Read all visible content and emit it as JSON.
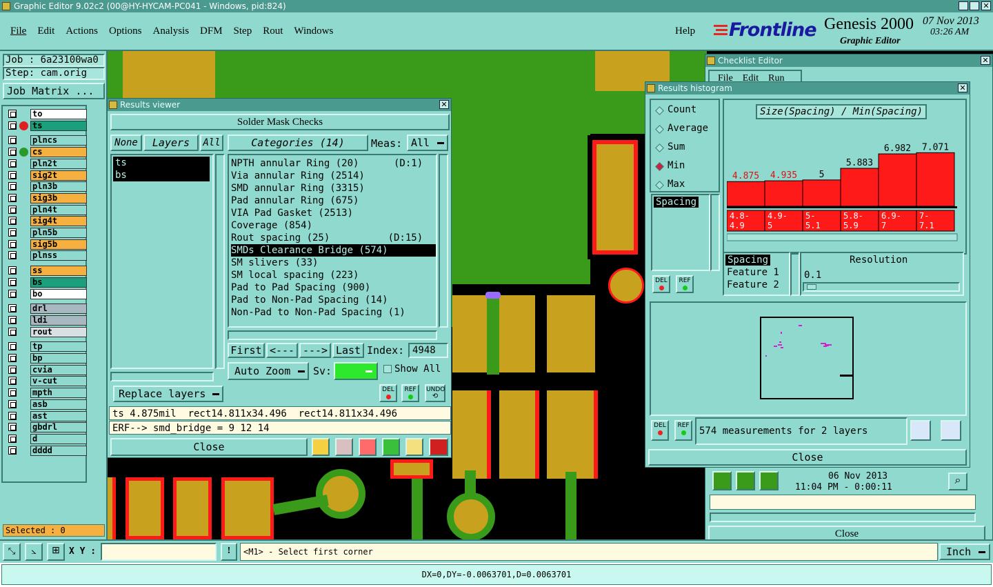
{
  "window_title": "Graphic Editor 9.02c2 (00@HY-HYCAM-PC041 - Windows, pid:824)",
  "menu": [
    "File",
    "Edit",
    "Actions",
    "Options",
    "Analysis",
    "DFM",
    "Step",
    "Rout",
    "Windows"
  ],
  "help": "Help",
  "brand": {
    "logo": "Frontline",
    "product": "Genesis 2000",
    "subtitle": "Graphic Editor",
    "date": "07 Nov 2013",
    "time": "03:26 AM"
  },
  "left": {
    "job": "Job : 6a23100wa0",
    "step": "Step: cam.orig",
    "job_matrix": "Job Matrix ...",
    "layers": [
      {
        "name": "to",
        "bg": "#ffffff"
      },
      {
        "name": "ts",
        "bg": "#1aa07a"
      },
      {
        "name": "plncs",
        "bg": "#8fd9ce"
      },
      {
        "name": "cs",
        "bg": "#f5b040"
      },
      {
        "name": "pln2t",
        "bg": "#8fd9ce"
      },
      {
        "name": "sig2t",
        "bg": "#f5b040"
      },
      {
        "name": "pln3b",
        "bg": "#8fd9ce"
      },
      {
        "name": "sig3b",
        "bg": "#f5b040"
      },
      {
        "name": "pln4t",
        "bg": "#8fd9ce"
      },
      {
        "name": "sig4t",
        "bg": "#f5b040"
      },
      {
        "name": "pln5b",
        "bg": "#8fd9ce"
      },
      {
        "name": "sig5b",
        "bg": "#f5b040"
      },
      {
        "name": "plnss",
        "bg": "#8fd9ce"
      },
      {
        "name": "ss",
        "bg": "#f5b040"
      },
      {
        "name": "bs",
        "bg": "#1aa07a"
      },
      {
        "name": "bo",
        "bg": "#ffffff"
      },
      {
        "name": "drl",
        "bg": "#a8b8c0"
      },
      {
        "name": "ldi",
        "bg": "#a8b8c0"
      },
      {
        "name": "rout",
        "bg": "#d8e0e4"
      },
      {
        "name": "tp",
        "bg": "#8fd9ce"
      },
      {
        "name": "bp",
        "bg": "#8fd9ce"
      },
      {
        "name": "cvia",
        "bg": "#8fd9ce"
      },
      {
        "name": "v-cut",
        "bg": "#8fd9ce"
      },
      {
        "name": "mpth",
        "bg": "#8fd9ce"
      },
      {
        "name": "asb",
        "bg": "#8fd9ce"
      },
      {
        "name": "ast",
        "bg": "#8fd9ce"
      },
      {
        "name": "gbdrl",
        "bg": "#8fd9ce"
      },
      {
        "name": "d",
        "bg": "#8fd9ce"
      },
      {
        "name": "dddd",
        "bg": "#8fd9ce"
      }
    ],
    "selected": "Selected : 0"
  },
  "results_viewer": {
    "title": "Results viewer",
    "header": "Solder Mask Checks",
    "none": "None",
    "layers_btn": "Layers",
    "all_btn": "All",
    "layers": [
      "ts",
      "bs"
    ],
    "categories_btn": "Categories (14)",
    "meas_label": "Meas:",
    "meas_value": "All",
    "categories": [
      "NPTH annular Ring (20)      (D:1)",
      "Via annular Ring (2514)",
      "SMD annular Ring (3315)",
      "Pad annular Ring (675)",
      "VIA Pad Gasket (2513)",
      "Coverage (854)",
      "Rout spacing (25)          (D:15)",
      "SMDs Clearance Bridge (574)",
      "SM slivers (33)",
      "SM local spacing (223)",
      "Pad to Pad Spacing (900)",
      "Pad to Non-Pad Spacing (14)",
      "Non-Pad to Non-Pad Spacing (1)"
    ],
    "selected_index": 7,
    "first": "First",
    "prev": "<---",
    "next": "--->",
    "last": "Last",
    "index_label": "Index:",
    "index_value": "4948",
    "auto_zoom": "Auto Zoom",
    "sv_label": "Sv:",
    "show_all": "Show All",
    "replace_layers": "Replace layers",
    "del": "DEL",
    "ref": "REF",
    "undo": "UNDO",
    "status1": "ts 4.875mil  rect14.811x34.496  rect14.811x34.496",
    "status2": "ERF--> smd_bridge = 9 12 14",
    "close": "Close"
  },
  "histogram": {
    "title": "Results histogram",
    "options": [
      "Count",
      "Average",
      "Sum",
      "Min",
      "Max"
    ],
    "selected_option": "Min",
    "chart_title": "Size(Spacing) / Min(Spacing)",
    "list_item": "Spacing",
    "features": [
      "Spacing",
      "Feature 1",
      "Feature 2"
    ],
    "resolution_label": "Resolution",
    "resolution_value": "0.1",
    "summary": "574 measurements for 2 layers",
    "close": "Close",
    "del": "DEL",
    "ref": "REF",
    "chart_data": {
      "type": "bar",
      "categories": [
        "4.8-4.9",
        "4.9-5",
        "5-5.1",
        "5.8-5.9",
        "6.9-7",
        "7-7.1"
      ],
      "category_lines": [
        [
          "4.8-",
          "4.9"
        ],
        [
          "4.9-",
          "5"
        ],
        [
          "5-",
          "5.1"
        ],
        [
          "5.8-",
          "5.9"
        ],
        [
          "6.9-",
          "7"
        ],
        [
          "7-",
          "7.1"
        ]
      ],
      "values": [
        4.875,
        4.935,
        5,
        5.883,
        6.982,
        7.071
      ],
      "value_labels": [
        "4.875",
        "4.935",
        "5",
        "5.883",
        "6.982",
        "7.071"
      ],
      "ylim": [
        3.0,
        7.3
      ],
      "bar_color": "#ff1a1a"
    }
  },
  "checklist": {
    "title": "Checklist Editor",
    "menu": [
      "File",
      "Edit",
      "Run"
    ],
    "date": "06 Nov 2013",
    "time": "11:04 PM - 0:00:11",
    "close": "Close"
  },
  "bottom": {
    "xy_label": "X Y :",
    "xy_value": "",
    "prompt": "<M1> - Select first corner",
    "units": "Inch",
    "coords": "DX=0,DY=-0.0063701,D=0.0063701"
  }
}
